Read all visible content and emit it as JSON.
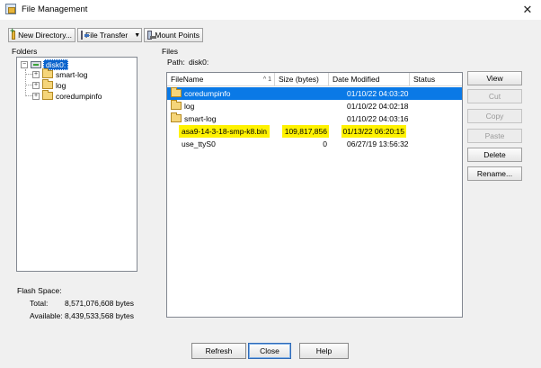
{
  "window": {
    "title": "File Management",
    "close_glyph": "✕"
  },
  "toolbar": {
    "new_directory": "New Directory...",
    "file_transfer": "File Transfer",
    "mount_points": "Mount Points"
  },
  "folders": {
    "label": "Folders",
    "root": "disk0:",
    "items": [
      "smart-log",
      "log",
      "coredumpinfo"
    ]
  },
  "flash": {
    "label": "Flash Space:",
    "total_label": "Total:",
    "total_value": "8,571,076,608 bytes",
    "available_label": "Available:",
    "available_value": "8,439,533,568 bytes"
  },
  "files": {
    "label": "Files",
    "path_label": "Path:",
    "path_value": "disk0:",
    "columns": [
      "FileName",
      "Size (bytes)",
      "Date Modified",
      "Status"
    ],
    "sort_indicator": "^ 1",
    "rows": [
      {
        "name": "coredumpinfo",
        "size": "",
        "date": "01/10/22 04:03:20",
        "status": "",
        "type": "folder",
        "selected": true
      },
      {
        "name": "log",
        "size": "",
        "date": "01/10/22 04:02:18",
        "status": "",
        "type": "folder"
      },
      {
        "name": "smart-log",
        "size": "",
        "date": "01/10/22 04:03:16",
        "status": "",
        "type": "folder"
      },
      {
        "name": "asa9-14-3-18-smp-k8.bin",
        "size": "109,817,856",
        "date": "01/13/22 06:20:15",
        "status": "",
        "type": "file",
        "highlight": "#fff200"
      },
      {
        "name": "use_ttyS0",
        "size": "0",
        "date": "06/27/19 13:56:32",
        "status": "",
        "type": "file"
      }
    ]
  },
  "actions": {
    "view": "View",
    "cut": "Cut",
    "copy": "Copy",
    "paste": "Paste",
    "delete": "Delete",
    "rename": "Rename..."
  },
  "footer": {
    "refresh": "Refresh",
    "close": "Close",
    "help": "Help"
  },
  "colors": {
    "selection": "#0a79e6",
    "highlight": "#fff200"
  }
}
